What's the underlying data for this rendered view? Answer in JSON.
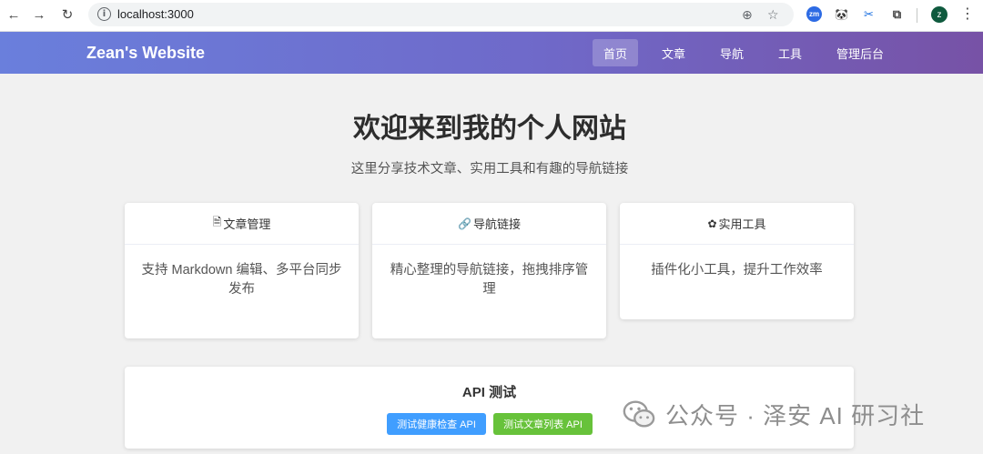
{
  "browser": {
    "url": "localhost:3000",
    "info_glyph": "i",
    "back_glyph": "←",
    "forward_glyph": "→",
    "reload_glyph": "↻",
    "zoom_glyph": "⊕",
    "star_glyph": "☆",
    "puzzle_glyph": "⧉",
    "profile_initial": "z",
    "menu_glyph": "⋮",
    "ext_zm": "zm",
    "ext_panda": "🐼",
    "ext_scissors": "✂"
  },
  "site": {
    "brand": "Zean's Website",
    "menu": [
      "首页",
      "文章",
      "导航",
      "工具",
      "管理后台"
    ]
  },
  "hero": {
    "title": "欢迎来到我的个人网站",
    "subtitle": "这里分享技术文章、实用工具和有趣的导航链接"
  },
  "cards": [
    {
      "icon": "document-icon",
      "glyph": "🗎",
      "title": "文章管理",
      "desc": "支持 Markdown 编辑、多平台同步发布"
    },
    {
      "icon": "link-icon",
      "glyph": "🔗",
      "title": "导航链接",
      "desc": "精心整理的导航链接，拖拽排序管理"
    },
    {
      "icon": "gear-icon",
      "glyph": "✿",
      "title": "实用工具",
      "desc": "插件化小工具，提升工作效率"
    }
  ],
  "api": {
    "title": "API 测试",
    "health_btn": "测试健康检查 API",
    "articles_btn": "测试文章列表 API"
  },
  "watermark": {
    "text": "公众号 · 泽安 AI 研习社"
  },
  "colors": {
    "header_start": "#6a7fdc",
    "header_end": "#7752a6",
    "btn_blue": "#409eff",
    "btn_green": "#67c23a"
  }
}
